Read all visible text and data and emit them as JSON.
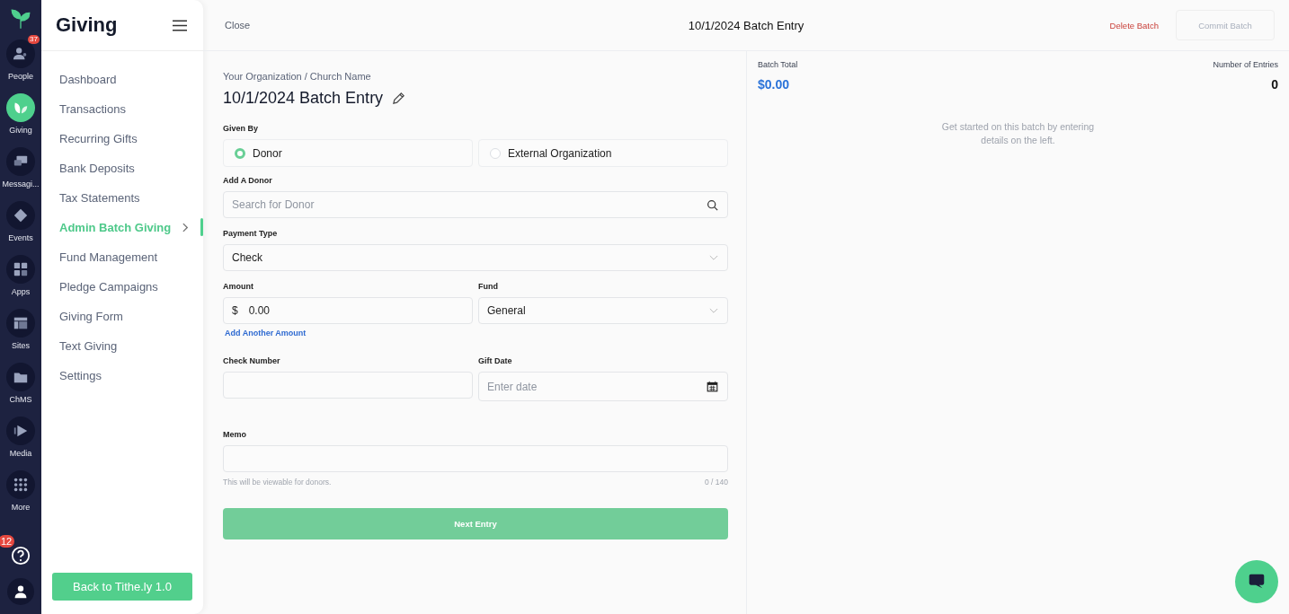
{
  "rail": {
    "items": [
      {
        "label": "People",
        "kind": "people",
        "selected": false,
        "badge": "37"
      },
      {
        "label": "Giving",
        "kind": "giving",
        "selected": true
      },
      {
        "label": "Messagi...",
        "kind": "messaging",
        "selected": false
      },
      {
        "label": "Events",
        "kind": "events",
        "selected": false
      },
      {
        "label": "Apps",
        "kind": "apps",
        "selected": false
      },
      {
        "label": "Sites",
        "kind": "sites",
        "selected": false
      },
      {
        "label": "ChMS",
        "kind": "chms",
        "selected": false
      },
      {
        "label": "Media",
        "kind": "media",
        "selected": false
      },
      {
        "label": "More",
        "kind": "more",
        "selected": false
      }
    ],
    "help_badge": "12"
  },
  "sidebar": {
    "title": "Giving",
    "items": [
      {
        "label": "Dashboard",
        "selected": false
      },
      {
        "label": "Transactions",
        "selected": false
      },
      {
        "label": "Recurring Gifts",
        "selected": false
      },
      {
        "label": "Bank Deposits",
        "selected": false
      },
      {
        "label": "Tax Statements",
        "selected": false
      },
      {
        "label": "Admin Batch Giving",
        "selected": true
      },
      {
        "label": "Fund Management",
        "selected": false
      },
      {
        "label": "Pledge Campaigns",
        "selected": false
      },
      {
        "label": "Giving Form",
        "selected": false
      },
      {
        "label": "Text Giving",
        "selected": false
      },
      {
        "label": "Settings",
        "selected": false
      }
    ],
    "back_button": "Back to Tithe.ly 1.0"
  },
  "header": {
    "close": "Close",
    "title": "10/1/2024 Batch Entry",
    "delete": "Delete Batch",
    "commit": "Commit Batch"
  },
  "form": {
    "breadcrumb": "Your Organization / Church Name",
    "title": "10/1/2024 Batch Entry",
    "given_by": {
      "label": "Given By",
      "options": [
        {
          "label": "Donor",
          "selected": true
        },
        {
          "label": "External Organization",
          "selected": false
        }
      ]
    },
    "donor": {
      "label": "Add A Donor",
      "placeholder": "Search for Donor"
    },
    "payment_type": {
      "label": "Payment Type",
      "value": "Check"
    },
    "amount": {
      "label": "Amount",
      "currency": "$",
      "value": "0.00"
    },
    "fund": {
      "label": "Fund",
      "value": "General"
    },
    "add_amount": "Add Another Amount",
    "check_number": {
      "label": "Check Number"
    },
    "gift_date": {
      "label": "Gift Date",
      "placeholder": "Enter date"
    },
    "memo": {
      "label": "Memo",
      "hint": "This will be viewable for donors.",
      "counter": "0 / 140"
    },
    "next": "Next Entry"
  },
  "summary": {
    "total_label": "Batch Total",
    "total": "$0.00",
    "entries_label": "Number of Entries",
    "entries": "0",
    "empty": "Get started on this batch by entering details on the left."
  }
}
